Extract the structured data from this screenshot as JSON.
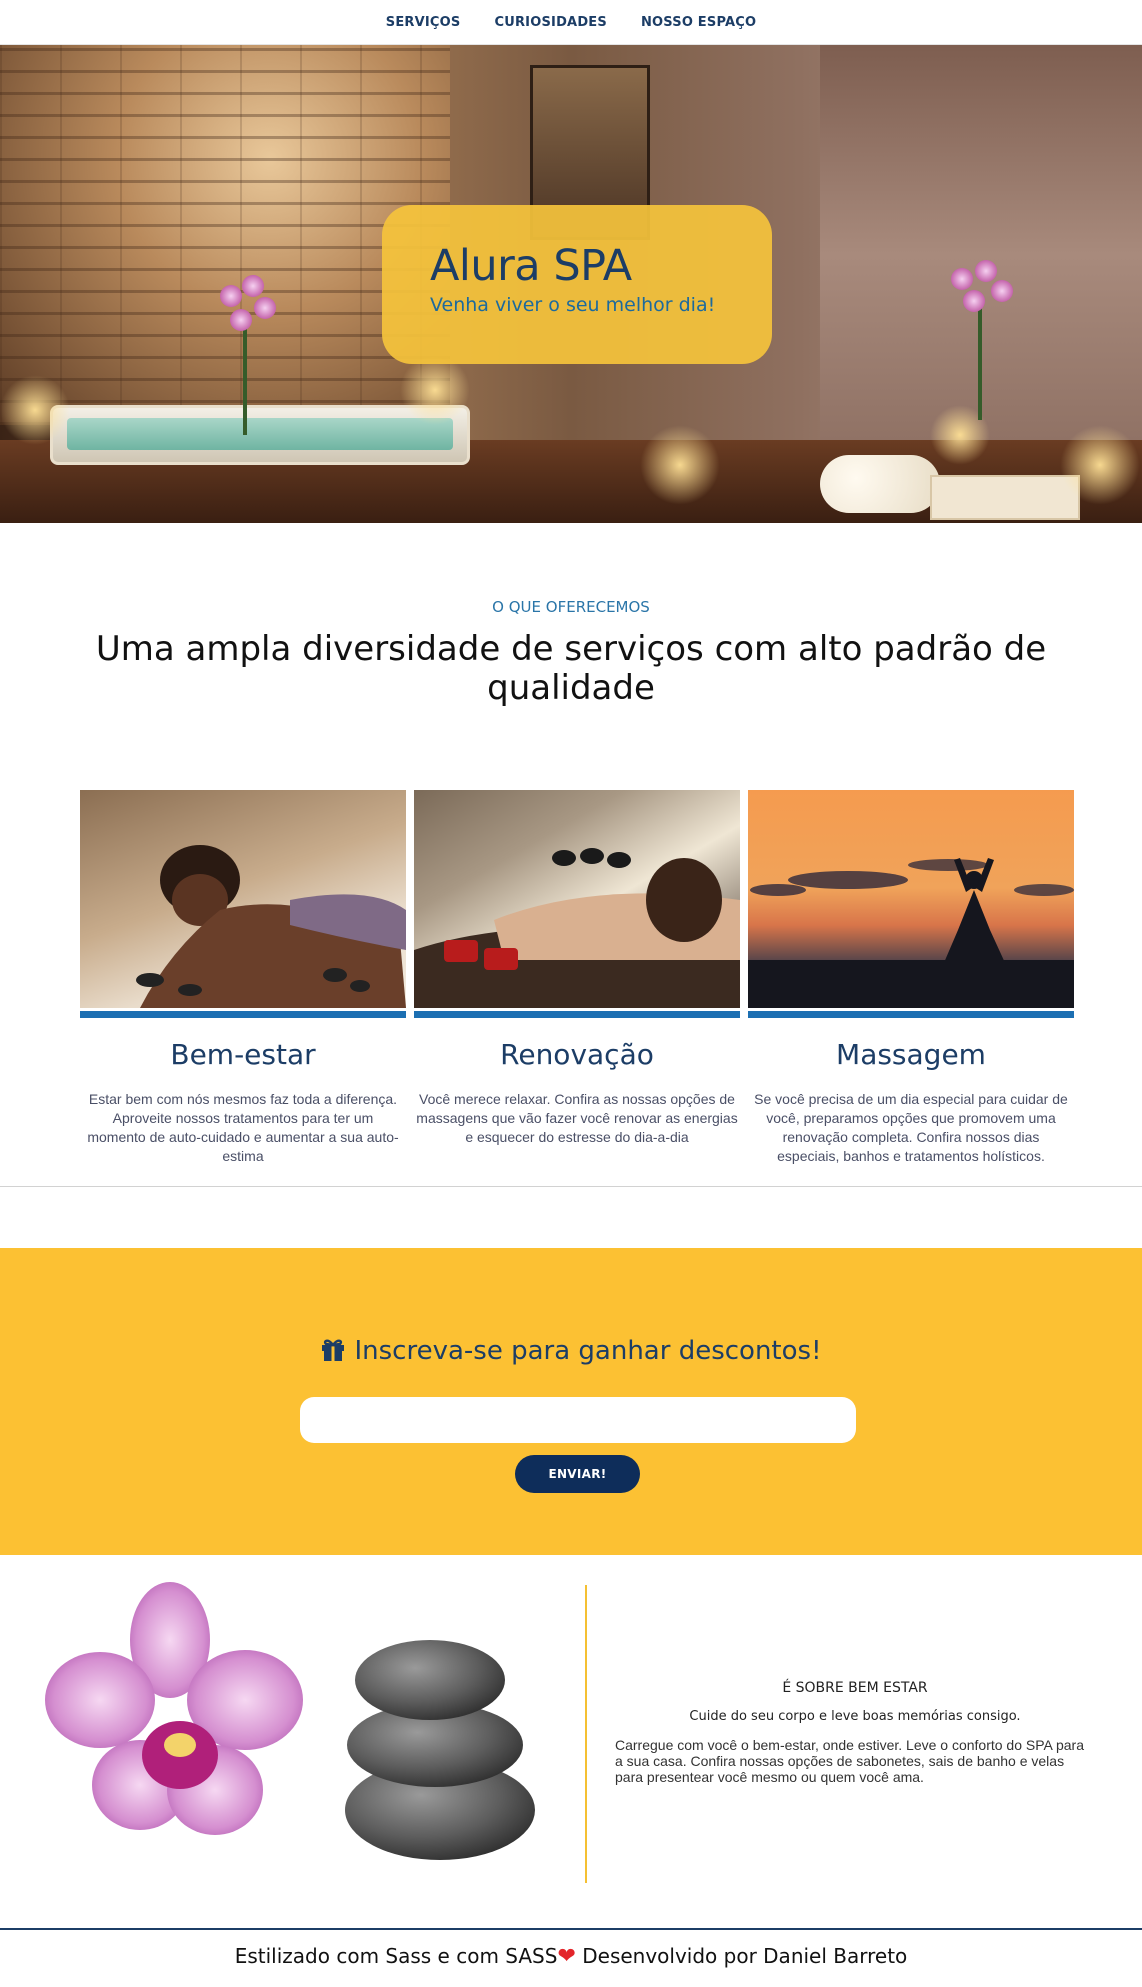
{
  "nav": {
    "items": [
      {
        "label": "SERVIÇOS"
      },
      {
        "label": "CURIOSIDADES"
      },
      {
        "label": "NOSSO ESPAÇO"
      }
    ]
  },
  "hero": {
    "title": "Alura SPA",
    "subtitle": "Venha viver o seu melhor dia!"
  },
  "offer": {
    "eyebrow": "O QUE OFERECEMOS",
    "headline": "Uma ampla diversidade de serviços com alto padrão de qualidade"
  },
  "cards": [
    {
      "title": "Bem-estar",
      "description": "Estar bem com nós mesmos faz toda a diferença. Aproveite nossos tratamentos para ter um momento de auto-cuidado e aumentar a sua auto-estima"
    },
    {
      "title": "Renovação",
      "description": "Você merece relaxar. Confira as nossas opções de massagens que vão fazer você renovar as energias e esquecer do estresse do dia-a-dia"
    },
    {
      "title": "Massagem",
      "description": "Se você precisa de um dia especial para cuidar de você, preparamos opções que promovem uma renovação completa. Confira nossos dias especiais, banhos e tratamentos holísticos."
    }
  ],
  "subscribe": {
    "title": "Inscreva-se para ganhar descontos!",
    "input_value": "",
    "button_label": "ENVIAR!"
  },
  "about": {
    "title": "É SOBRE BEM ESTAR",
    "subtitle": "Cuide do seu corpo e leve boas memórias consigo.",
    "body": "Carregue com você o bem-estar, onde estiver. Leve o conforto do SPA para a sua casa. Confira nossas opções de sabonetes, sais de banho e velas para presentear você mesmo ou quem você ama."
  },
  "footer": {
    "text_before": "Estilizado com Sass e com SASS",
    "text_after": " Desenvolvido por Daniel Barreto"
  },
  "colors": {
    "brand_navy": "#1c3d66",
    "accent_yellow": "#fcc133",
    "accent_blue": "#1c6fb2",
    "button_navy": "#0e2d5a",
    "heart_red": "#e3252a"
  }
}
